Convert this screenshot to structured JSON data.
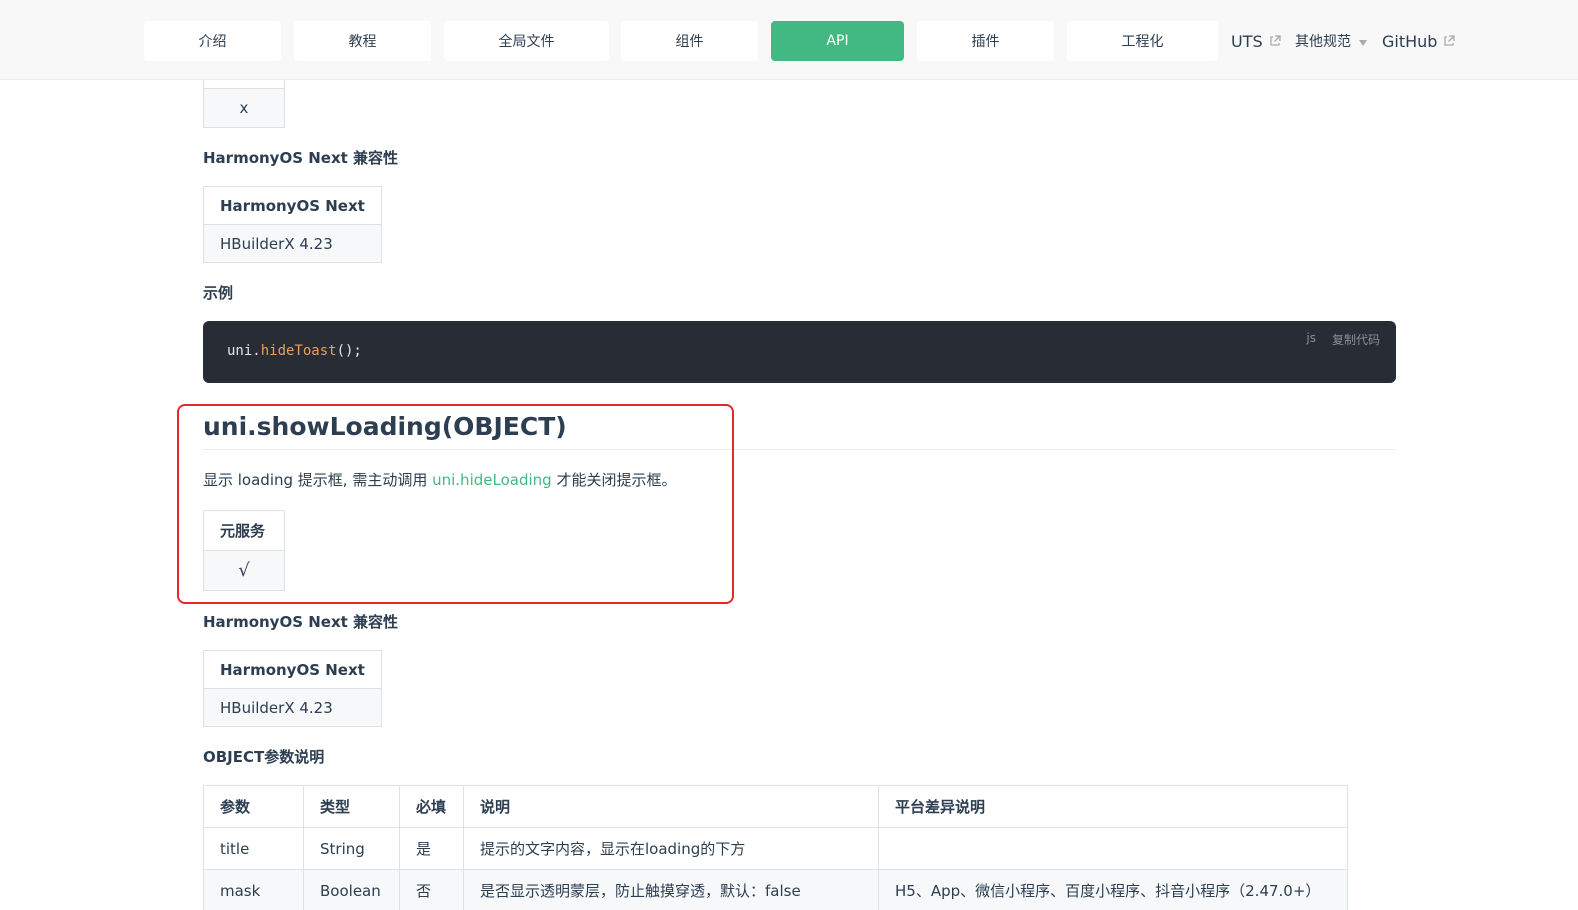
{
  "nav": {
    "items": [
      {
        "label": "介绍"
      },
      {
        "label": "教程"
      },
      {
        "label": "全局文件"
      },
      {
        "label": "组件"
      },
      {
        "label": "API"
      },
      {
        "label": "插件"
      },
      {
        "label": "工程化"
      }
    ],
    "links": {
      "uts": "UTS",
      "other": "其他规范",
      "github": "GitHub"
    },
    "active_color": "#42b983"
  },
  "prev_section": {
    "top_table_cell": "x",
    "harmony_heading": "HarmonyOS Next 兼容性",
    "harmony_table": {
      "header": "HarmonyOS Next",
      "value": "HBuilderX 4.23"
    },
    "example_heading": "示例",
    "code": {
      "obj": "uni.",
      "fn": "hideToast",
      "rest": "();",
      "lang": "js",
      "copy_label": "复制代码"
    }
  },
  "section": {
    "title": "uni.showLoading(OBJECT)",
    "desc_before": "显示 loading 提示框, 需主动调用 ",
    "desc_link": "uni.hideLoading",
    "desc_after": " 才能关闭提示框。",
    "service_table": {
      "header": "元服务",
      "value": "√"
    },
    "harmony_heading": "HarmonyOS Next 兼容性",
    "harmony_table": {
      "header": "HarmonyOS Next",
      "value": "HBuilderX 4.23"
    },
    "params_heading": "OBJECT参数说明",
    "params": {
      "headers": [
        "参数",
        "类型",
        "必填",
        "说明",
        "平台差异说明"
      ],
      "rows": [
        [
          "title",
          "String",
          "是",
          "提示的文字内容，显示在loading的下方",
          ""
        ],
        [
          "mask",
          "Boolean",
          "否",
          "是否显示透明蒙层，防止触摸穿透，默认：false",
          "H5、App、微信小程序、百度小程序、抖音小程序（2.47.0+）"
        ]
      ]
    }
  },
  "highlight_color": "#e02b2b"
}
